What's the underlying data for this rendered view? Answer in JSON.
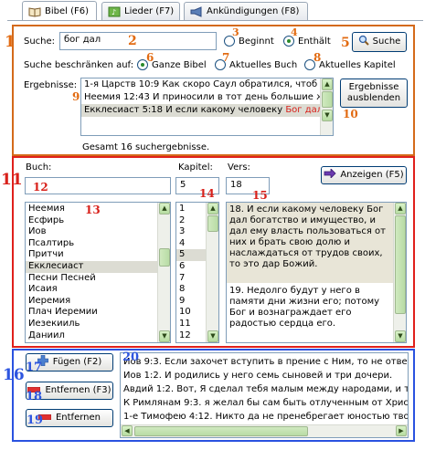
{
  "tabs": [
    {
      "label": "Bibel (F6)",
      "icon": "book-icon"
    },
    {
      "label": "Lieder (F7)",
      "icon": "music-icon"
    },
    {
      "label": "Ankündigungen (F8)",
      "icon": "megaphone-icon"
    }
  ],
  "search": {
    "label": "Suche:",
    "value": "бог дал",
    "mode_begins": "Beginnt",
    "mode_contains": "Enthält",
    "mode_selected": "Enthält",
    "button": "Suche",
    "restrict_label": "Suche beschränken auf:",
    "scope_whole": "Ganze Bibel",
    "scope_book": "Aktuelles Buch",
    "scope_chapter": "Aktuelles Kapitel",
    "scope_selected": "Ganze Bibel",
    "results_label": "Ergebnisse:",
    "results": [
      {
        "text": "1-я Царств 10:9 Как скоро Саул обратился, чтоб и",
        "hl": ""
      },
      {
        "text": "Неемия 12:43 И приносили в тот день большие же",
        "hl": ""
      },
      {
        "text": "Екклесиаст 5:18 И если какому человеку ",
        "hl": "Бог дал б"
      }
    ],
    "clear_button": "Ergebnisse ausblenden",
    "total": "Gesamt 16 suchergebnisse."
  },
  "nav": {
    "book_label": "Buch:",
    "chapter_label": "Kapitel:",
    "verse_label": "Vers:",
    "show_button": "Anzeigen (F5)",
    "chapter_value": "5",
    "verse_value": "18",
    "books": [
      "Неемия",
      "Есфирь",
      "Иов",
      "Псалтирь",
      "Притчи",
      "Екклесиаст",
      "Песни Песней",
      "Исаия",
      "Иеремия",
      "Плач Иеремии",
      "Иезекииль",
      "Даниил"
    ],
    "selected_book": "Екклесиаст",
    "chapters": [
      "1",
      "2",
      "3",
      "4",
      "5",
      "6",
      "7",
      "8",
      "9",
      "10",
      "11",
      "12"
    ],
    "selected_chapter": "5",
    "verse_text_1": "18. И если какому человеку Бог дал богатство и имущество, и дал ему власть пользоваться от них и брать свою долю и наслаждаться от трудов своих, то это дар Божий.",
    "verse_text_2": "19. Недолго будут у него в памяти дни жизни его; потому Бог и вознаграждает его радостью сердца его."
  },
  "queue": {
    "add_button": "Fügen (F2)",
    "remove_button": "Entfernen (F3)",
    "remove_all_button": "Entfernen",
    "items": [
      "Иов 9:3. Если захочет вступить в прение с Ним, то не ответи",
      "Иов 1:2. И родились у него семь сыновей и три дочери.",
      "Авдий 1:2. Вот, Я сделал тебя малым между народами, и ты",
      "К Римлянам 9:3. я желал бы сам быть отлученным от Христа",
      "1-е Тимофею 4:12. Никто да не пренебрегает юностью твое"
    ]
  },
  "annotations": [
    "1",
    "2",
    "3",
    "4",
    "5",
    "6",
    "7",
    "8",
    "9",
    "10",
    "11",
    "12",
    "13",
    "14",
    "15",
    "16",
    "17",
    "18",
    "19",
    "20"
  ],
  "colors": {
    "orange": "#d46a1a",
    "red": "#e0201b",
    "blue": "#2a52e0"
  }
}
